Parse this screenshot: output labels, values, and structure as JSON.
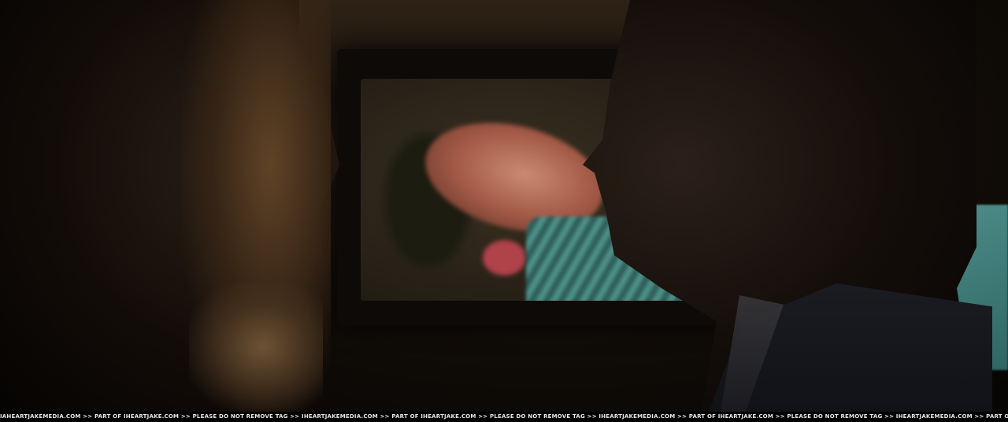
{
  "image": {
    "description_tag": "film-still",
    "palette": {
      "background": "#050403",
      "screen_glow": "#3a3122",
      "skin_on_screen": "#c98a72",
      "teal_accent": "#4e8e8a"
    }
  },
  "watermark": {
    "text": "IAHEARTJAKEMEDIA.COM >> PART OF IHEARTJAKE.COM >> PLEASE DO NOT REMOVE TAG >> IHEARTJAKEMEDIA.COM >> PART OF IHEARTJAKE.COM >> PLEASE DO NOT REMOVE TAG >> IHEARTJAKEMEDIA.COM >> PART OF IHEARTJAKE.COM >> PLEASE DO NOT REMOVE TAG >> IHEARTJAKEMEDIA.COM >> PART OF IHEARTJAKE.COM >> PLEASE"
  }
}
